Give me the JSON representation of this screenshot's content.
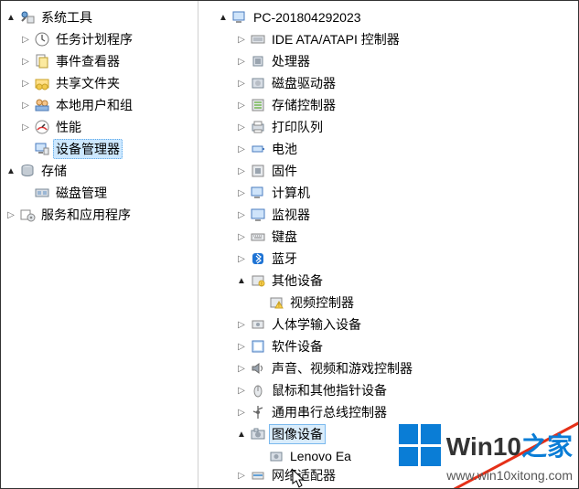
{
  "leftTree": {
    "systemTools": {
      "label": "系统工具",
      "children": {
        "taskScheduler": "任务计划程序",
        "eventViewer": "事件查看器",
        "sharedFolders": "共享文件夹",
        "localUsers": "本地用户和组",
        "performance": "性能",
        "deviceManager": "设备管理器"
      }
    },
    "storage": {
      "label": "存储",
      "children": {
        "diskMgmt": "磁盘管理"
      }
    },
    "servicesApps": {
      "label": "服务和应用程序"
    }
  },
  "rightTree": {
    "rootName": "PC-201804292023",
    "items": [
      {
        "key": "ide",
        "label": "IDE ATA/ATAPI 控制器",
        "icon": "ide"
      },
      {
        "key": "cpu",
        "label": "处理器",
        "icon": "cpu"
      },
      {
        "key": "diskDrive",
        "label": "磁盘驱动器",
        "icon": "disk"
      },
      {
        "key": "storageCtrl",
        "label": "存储控制器",
        "icon": "storage"
      },
      {
        "key": "printQueue",
        "label": "打印队列",
        "icon": "printer"
      },
      {
        "key": "battery",
        "label": "电池",
        "icon": "battery"
      },
      {
        "key": "firmware",
        "label": "固件",
        "icon": "firmware"
      },
      {
        "key": "computer",
        "label": "计算机",
        "icon": "computer"
      },
      {
        "key": "monitor",
        "label": "监视器",
        "icon": "monitor"
      },
      {
        "key": "keyboard",
        "label": "键盘",
        "icon": "keyboard"
      },
      {
        "key": "bluetooth",
        "label": "蓝牙",
        "icon": "bluetooth"
      },
      {
        "key": "other",
        "label": "其他设备",
        "icon": "other",
        "expanded": true,
        "child": {
          "key": "videoCtrl",
          "label": "视频控制器",
          "icon": "warn"
        }
      },
      {
        "key": "hid",
        "label": "人体学输入设备",
        "icon": "hid"
      },
      {
        "key": "software",
        "label": "软件设备",
        "icon": "software"
      },
      {
        "key": "sound",
        "label": "声音、视频和游戏控制器",
        "icon": "sound"
      },
      {
        "key": "mouse",
        "label": "鼠标和其他指针设备",
        "icon": "mouse"
      },
      {
        "key": "usb",
        "label": "通用串行总线控制器",
        "icon": "usb",
        "truncated": true
      },
      {
        "key": "imaging",
        "label": "图像设备",
        "icon": "imaging",
        "expanded": true,
        "highlighted": true,
        "child": {
          "key": "lenovo",
          "label": "Lenovo Ea",
          "icon": "camera",
          "truncated": true
        }
      },
      {
        "key": "network",
        "label": "网络适配器",
        "icon": "network",
        "partiallyHidden": true
      }
    ]
  },
  "watermark": {
    "brandMain": "Win10",
    "brandAccent": "之家",
    "url": "www.win10xitong.com"
  }
}
